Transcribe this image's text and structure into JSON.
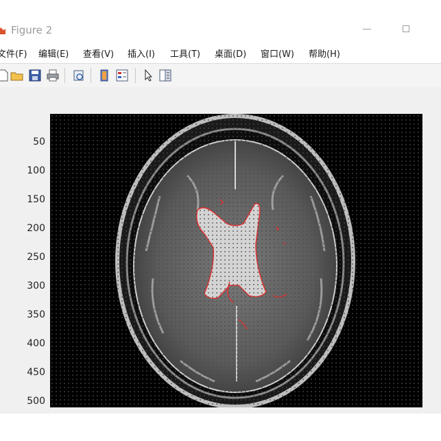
{
  "window": {
    "title": "Figure 2"
  },
  "menu": [
    {
      "label": "文件(F)"
    },
    {
      "label": "编辑(E)"
    },
    {
      "label": "查看(V)"
    },
    {
      "label": "插入(I)"
    },
    {
      "label": "工具(T)"
    },
    {
      "label": "桌面(D)"
    },
    {
      "label": "窗口(W)"
    },
    {
      "label": "帮助(H)"
    }
  ],
  "toolbar": {
    "buttons": [
      "new-figure-icon",
      "open-folder-icon",
      "save-icon",
      "print-icon",
      "print-preview-icon",
      "colorbar-icon",
      "legend-icon",
      "pointer-icon",
      "property-editor-icon"
    ]
  },
  "axes": {
    "y_ticks": [
      "50",
      "100",
      "150",
      "200",
      "250",
      "300",
      "350",
      "400",
      "450",
      "500"
    ],
    "image_description_colors": {
      "background": "#000000",
      "contour": "#e03030"
    }
  }
}
